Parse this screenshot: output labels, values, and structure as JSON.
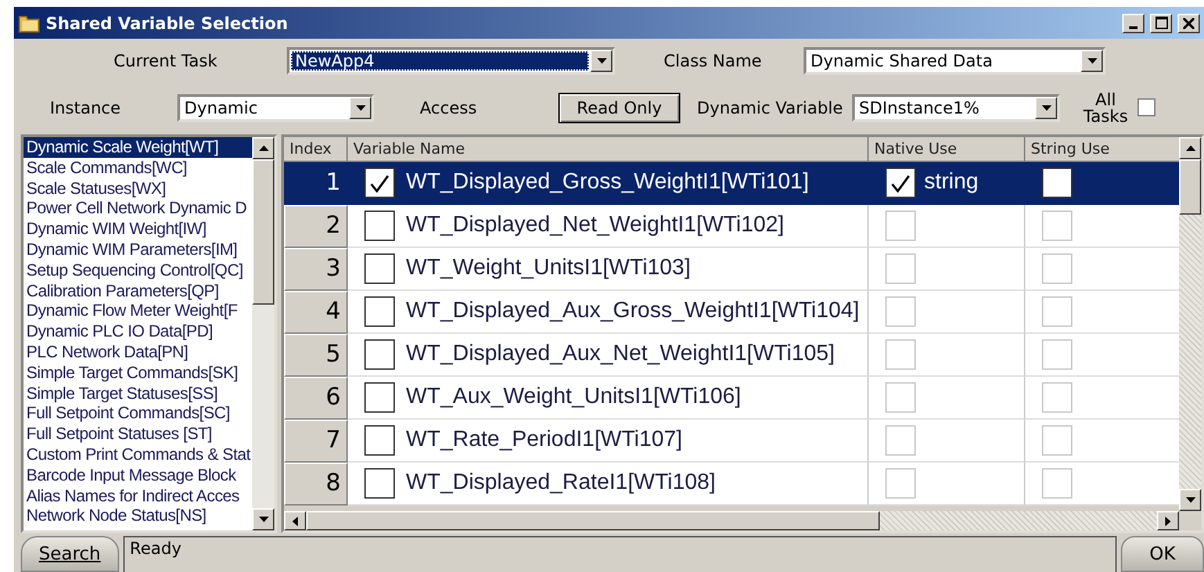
{
  "window": {
    "title": "Shared Variable Selection"
  },
  "current_task": {
    "label": "Current Task",
    "value": "NewApp4",
    "selected": true
  },
  "class_name": {
    "label": "Class Name",
    "value": "Dynamic Shared Data"
  },
  "instance": {
    "label": "Instance",
    "value": "Dynamic"
  },
  "access": {
    "label": "Access",
    "button": "Read Only"
  },
  "dynamic_variable": {
    "label": "Dynamic Variable",
    "value": "SDInstance1%"
  },
  "all_tasks": {
    "label": "All Tasks",
    "checked": false
  },
  "class_list": [
    {
      "label": "Dynamic Scale Weight[WT]",
      "selected": true
    },
    {
      "label": "Scale Commands[WC]",
      "selected": false
    },
    {
      "label": "Scale Statuses[WX]",
      "selected": false
    },
    {
      "label": "Power Cell Network Dynamic D",
      "selected": false
    },
    {
      "label": "Dynamic WIM Weight[IW]",
      "selected": false
    },
    {
      "label": "Dynamic WIM Parameters[IM]",
      "selected": false
    },
    {
      "label": "Setup Sequencing Control[QC]",
      "selected": false
    },
    {
      "label": "Calibration Parameters[QP]",
      "selected": false
    },
    {
      "label": "Dynamic Flow Meter Weight[F",
      "selected": false
    },
    {
      "label": "Dynamic PLC IO Data[PD]",
      "selected": false
    },
    {
      "label": "PLC Network Data[PN]",
      "selected": false
    },
    {
      "label": "Simple Target Commands[SK]",
      "selected": false
    },
    {
      "label": "Simple Target Statuses[SS]",
      "selected": false
    },
    {
      "label": "Full Setpoint Commands[SC]",
      "selected": false
    },
    {
      "label": "Full Setpoint Statuses [ST]",
      "selected": false
    },
    {
      "label": "Custom Print Commands & Stat",
      "selected": false
    },
    {
      "label": "Barcode Input Message Block",
      "selected": false
    },
    {
      "label": "Alias Names for Indirect Acces",
      "selected": false
    },
    {
      "label": "Network Node Status[NS]",
      "selected": false
    }
  ],
  "table": {
    "columns": [
      "Index",
      "Variable Name",
      "Native Use",
      "String Use"
    ],
    "rows": [
      {
        "index": "1",
        "name": "WT_Displayed_Gross_WeightI1[WTi101]",
        "checked": true,
        "selected": true,
        "native_use": {
          "checked": true,
          "disabled": false,
          "text": "string"
        },
        "string_use": {
          "checked": false,
          "disabled": false
        }
      },
      {
        "index": "2",
        "name": "WT_Displayed_Net_WeightI1[WTi102]",
        "checked": false,
        "selected": false,
        "native_use": {
          "checked": false,
          "disabled": true
        },
        "string_use": {
          "checked": false,
          "disabled": true
        }
      },
      {
        "index": "3",
        "name": "WT_Weight_UnitsI1[WTi103]",
        "checked": false,
        "selected": false,
        "native_use": {
          "checked": false,
          "disabled": true
        },
        "string_use": {
          "checked": false,
          "disabled": true
        }
      },
      {
        "index": "4",
        "name": "WT_Displayed_Aux_Gross_WeightI1[WTi104]",
        "checked": false,
        "selected": false,
        "native_use": {
          "checked": false,
          "disabled": true
        },
        "string_use": {
          "checked": false,
          "disabled": true
        }
      },
      {
        "index": "5",
        "name": "WT_Displayed_Aux_Net_WeightI1[WTi105]",
        "checked": false,
        "selected": false,
        "native_use": {
          "checked": false,
          "disabled": true
        },
        "string_use": {
          "checked": false,
          "disabled": true
        }
      },
      {
        "index": "6",
        "name": "WT_Aux_Weight_UnitsI1[WTi106]",
        "checked": false,
        "selected": false,
        "native_use": {
          "checked": false,
          "disabled": true
        },
        "string_use": {
          "checked": false,
          "disabled": true
        }
      },
      {
        "index": "7",
        "name": "WT_Rate_PeriodI1[WTi107]",
        "checked": false,
        "selected": false,
        "native_use": {
          "checked": false,
          "disabled": true
        },
        "string_use": {
          "checked": false,
          "disabled": true
        }
      },
      {
        "index": "8",
        "name": "WT_Displayed_RateI1[WTi108]",
        "checked": false,
        "selected": false,
        "native_use": {
          "checked": false,
          "disabled": true
        },
        "string_use": {
          "checked": false,
          "disabled": true
        }
      }
    ]
  },
  "status_bar": {
    "search_button": "Search",
    "status": "Ready",
    "ok_button": "OK"
  }
}
